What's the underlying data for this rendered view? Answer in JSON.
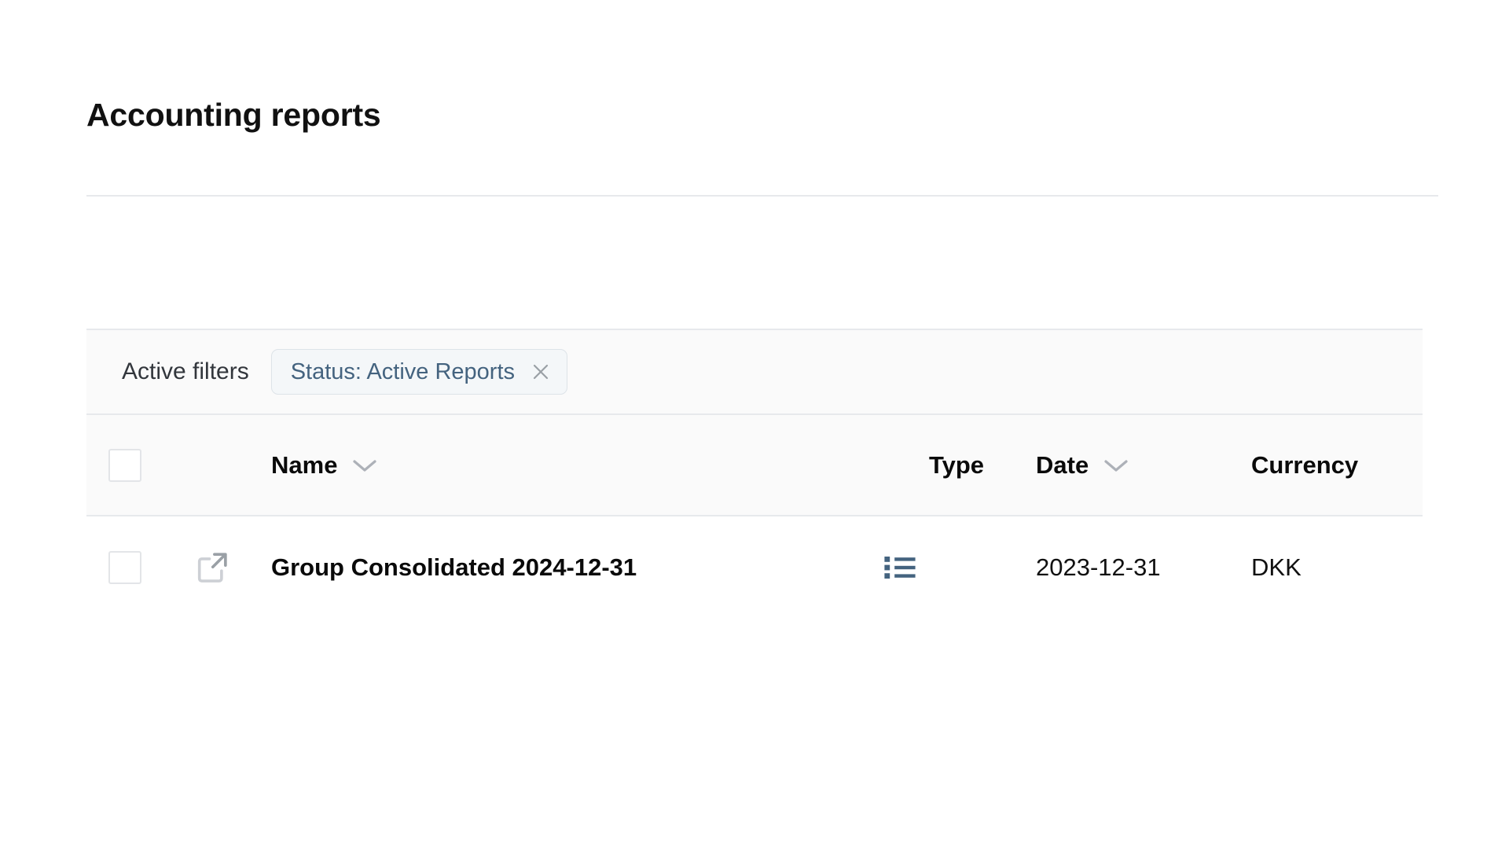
{
  "page": {
    "title": "Accounting reports"
  },
  "filters": {
    "label": "Active filters",
    "chips": [
      {
        "text": "Status: Active Reports",
        "close_icon": "close-icon"
      }
    ]
  },
  "table": {
    "columns": [
      {
        "key": "select",
        "label": "",
        "icon": "checkbox-icon",
        "sortable": false
      },
      {
        "key": "open",
        "label": "",
        "icon": "external-link-icon",
        "sortable": false
      },
      {
        "key": "name",
        "label": "Name",
        "sortable": true,
        "sort_icon": "chevron-down-icon"
      },
      {
        "key": "type",
        "label": "Type",
        "sortable": false
      },
      {
        "key": "date",
        "label": "Date",
        "sortable": true,
        "sort_icon": "chevron-down-icon"
      },
      {
        "key": "currency",
        "label": "Currency",
        "sortable": false
      }
    ],
    "header_select_all_checked": false,
    "rows": [
      {
        "selected": false,
        "open_icon": "external-link-icon",
        "name": "Group Consolidated 2024-12-31",
        "type_icon": "list-icon",
        "date": "2023-12-31",
        "currency": "DKK"
      }
    ]
  },
  "colors": {
    "accent": "#44637f",
    "chip_bg": "#f4f7f9",
    "chip_border": "#dde3e8",
    "header_bg": "#fafafa",
    "border": "#e7e9ec",
    "text": "#0a0a0a",
    "icon_gray": "#b9bcc2"
  }
}
